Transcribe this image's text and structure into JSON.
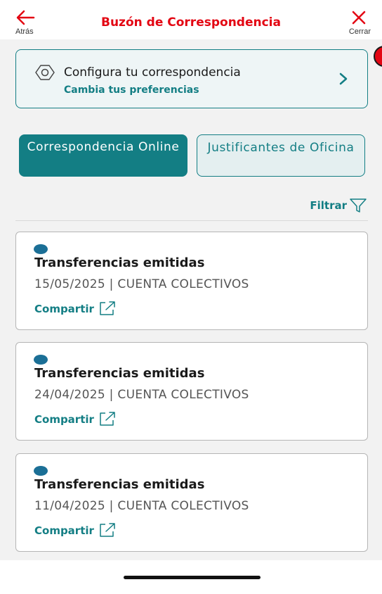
{
  "header": {
    "back_label": "Atrás",
    "title": "Buzón de Correspondencia",
    "close_label": "Cerrar"
  },
  "config": {
    "title": "Configura tu correspondencia",
    "subtitle": "Cambia tus preferencias",
    "icon": "gear-icon"
  },
  "tabs": [
    {
      "label": "Correspondencia Online",
      "active": true
    },
    {
      "label": "Justificantes de Oficina",
      "active": false
    }
  ],
  "filter": {
    "label": "Filtrar",
    "icon": "filter-icon"
  },
  "items": [
    {
      "title": "Transferencias emitidas",
      "meta": "15/05/2025 | CUENTA COLECTIVOS",
      "share_label": "Compartir"
    },
    {
      "title": "Transferencias emitidas",
      "meta": "24/04/2025 | CUENTA COLECTIVOS",
      "share_label": "Compartir"
    },
    {
      "title": "Transferencias emitidas",
      "meta": "11/04/2025 | CUENTA COLECTIVOS",
      "share_label": "Compartir"
    }
  ],
  "colors": {
    "brand_red": "#e30613",
    "accent_teal": "#137e84",
    "unread_blue": "#1b6f96"
  }
}
